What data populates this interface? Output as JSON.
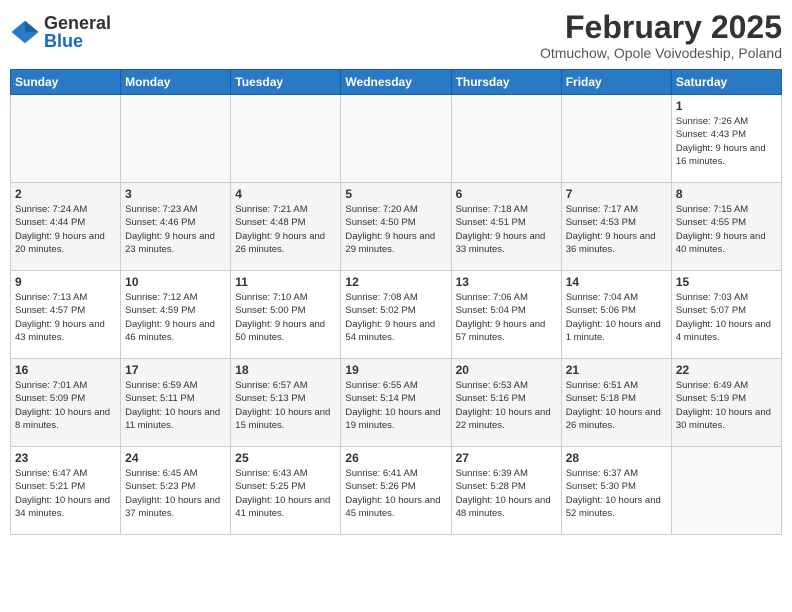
{
  "logo": {
    "general": "General",
    "blue": "Blue"
  },
  "title": "February 2025",
  "subtitle": "Otmuchow, Opole Voivodeship, Poland",
  "weekdays": [
    "Sunday",
    "Monday",
    "Tuesday",
    "Wednesday",
    "Thursday",
    "Friday",
    "Saturday"
  ],
  "weeks": [
    [
      {
        "day": "",
        "info": ""
      },
      {
        "day": "",
        "info": ""
      },
      {
        "day": "",
        "info": ""
      },
      {
        "day": "",
        "info": ""
      },
      {
        "day": "",
        "info": ""
      },
      {
        "day": "",
        "info": ""
      },
      {
        "day": "1",
        "info": "Sunrise: 7:26 AM\nSunset: 4:43 PM\nDaylight: 9 hours and 16 minutes."
      }
    ],
    [
      {
        "day": "2",
        "info": "Sunrise: 7:24 AM\nSunset: 4:44 PM\nDaylight: 9 hours and 20 minutes."
      },
      {
        "day": "3",
        "info": "Sunrise: 7:23 AM\nSunset: 4:46 PM\nDaylight: 9 hours and 23 minutes."
      },
      {
        "day": "4",
        "info": "Sunrise: 7:21 AM\nSunset: 4:48 PM\nDaylight: 9 hours and 26 minutes."
      },
      {
        "day": "5",
        "info": "Sunrise: 7:20 AM\nSunset: 4:50 PM\nDaylight: 9 hours and 29 minutes."
      },
      {
        "day": "6",
        "info": "Sunrise: 7:18 AM\nSunset: 4:51 PM\nDaylight: 9 hours and 33 minutes."
      },
      {
        "day": "7",
        "info": "Sunrise: 7:17 AM\nSunset: 4:53 PM\nDaylight: 9 hours and 36 minutes."
      },
      {
        "day": "8",
        "info": "Sunrise: 7:15 AM\nSunset: 4:55 PM\nDaylight: 9 hours and 40 minutes."
      }
    ],
    [
      {
        "day": "9",
        "info": "Sunrise: 7:13 AM\nSunset: 4:57 PM\nDaylight: 9 hours and 43 minutes."
      },
      {
        "day": "10",
        "info": "Sunrise: 7:12 AM\nSunset: 4:59 PM\nDaylight: 9 hours and 46 minutes."
      },
      {
        "day": "11",
        "info": "Sunrise: 7:10 AM\nSunset: 5:00 PM\nDaylight: 9 hours and 50 minutes."
      },
      {
        "day": "12",
        "info": "Sunrise: 7:08 AM\nSunset: 5:02 PM\nDaylight: 9 hours and 54 minutes."
      },
      {
        "day": "13",
        "info": "Sunrise: 7:06 AM\nSunset: 5:04 PM\nDaylight: 9 hours and 57 minutes."
      },
      {
        "day": "14",
        "info": "Sunrise: 7:04 AM\nSunset: 5:06 PM\nDaylight: 10 hours and 1 minute."
      },
      {
        "day": "15",
        "info": "Sunrise: 7:03 AM\nSunset: 5:07 PM\nDaylight: 10 hours and 4 minutes."
      }
    ],
    [
      {
        "day": "16",
        "info": "Sunrise: 7:01 AM\nSunset: 5:09 PM\nDaylight: 10 hours and 8 minutes."
      },
      {
        "day": "17",
        "info": "Sunrise: 6:59 AM\nSunset: 5:11 PM\nDaylight: 10 hours and 11 minutes."
      },
      {
        "day": "18",
        "info": "Sunrise: 6:57 AM\nSunset: 5:13 PM\nDaylight: 10 hours and 15 minutes."
      },
      {
        "day": "19",
        "info": "Sunrise: 6:55 AM\nSunset: 5:14 PM\nDaylight: 10 hours and 19 minutes."
      },
      {
        "day": "20",
        "info": "Sunrise: 6:53 AM\nSunset: 5:16 PM\nDaylight: 10 hours and 22 minutes."
      },
      {
        "day": "21",
        "info": "Sunrise: 6:51 AM\nSunset: 5:18 PM\nDaylight: 10 hours and 26 minutes."
      },
      {
        "day": "22",
        "info": "Sunrise: 6:49 AM\nSunset: 5:19 PM\nDaylight: 10 hours and 30 minutes."
      }
    ],
    [
      {
        "day": "23",
        "info": "Sunrise: 6:47 AM\nSunset: 5:21 PM\nDaylight: 10 hours and 34 minutes."
      },
      {
        "day": "24",
        "info": "Sunrise: 6:45 AM\nSunset: 5:23 PM\nDaylight: 10 hours and 37 minutes."
      },
      {
        "day": "25",
        "info": "Sunrise: 6:43 AM\nSunset: 5:25 PM\nDaylight: 10 hours and 41 minutes."
      },
      {
        "day": "26",
        "info": "Sunrise: 6:41 AM\nSunset: 5:26 PM\nDaylight: 10 hours and 45 minutes."
      },
      {
        "day": "27",
        "info": "Sunrise: 6:39 AM\nSunset: 5:28 PM\nDaylight: 10 hours and 48 minutes."
      },
      {
        "day": "28",
        "info": "Sunrise: 6:37 AM\nSunset: 5:30 PM\nDaylight: 10 hours and 52 minutes."
      },
      {
        "day": "",
        "info": ""
      }
    ]
  ]
}
